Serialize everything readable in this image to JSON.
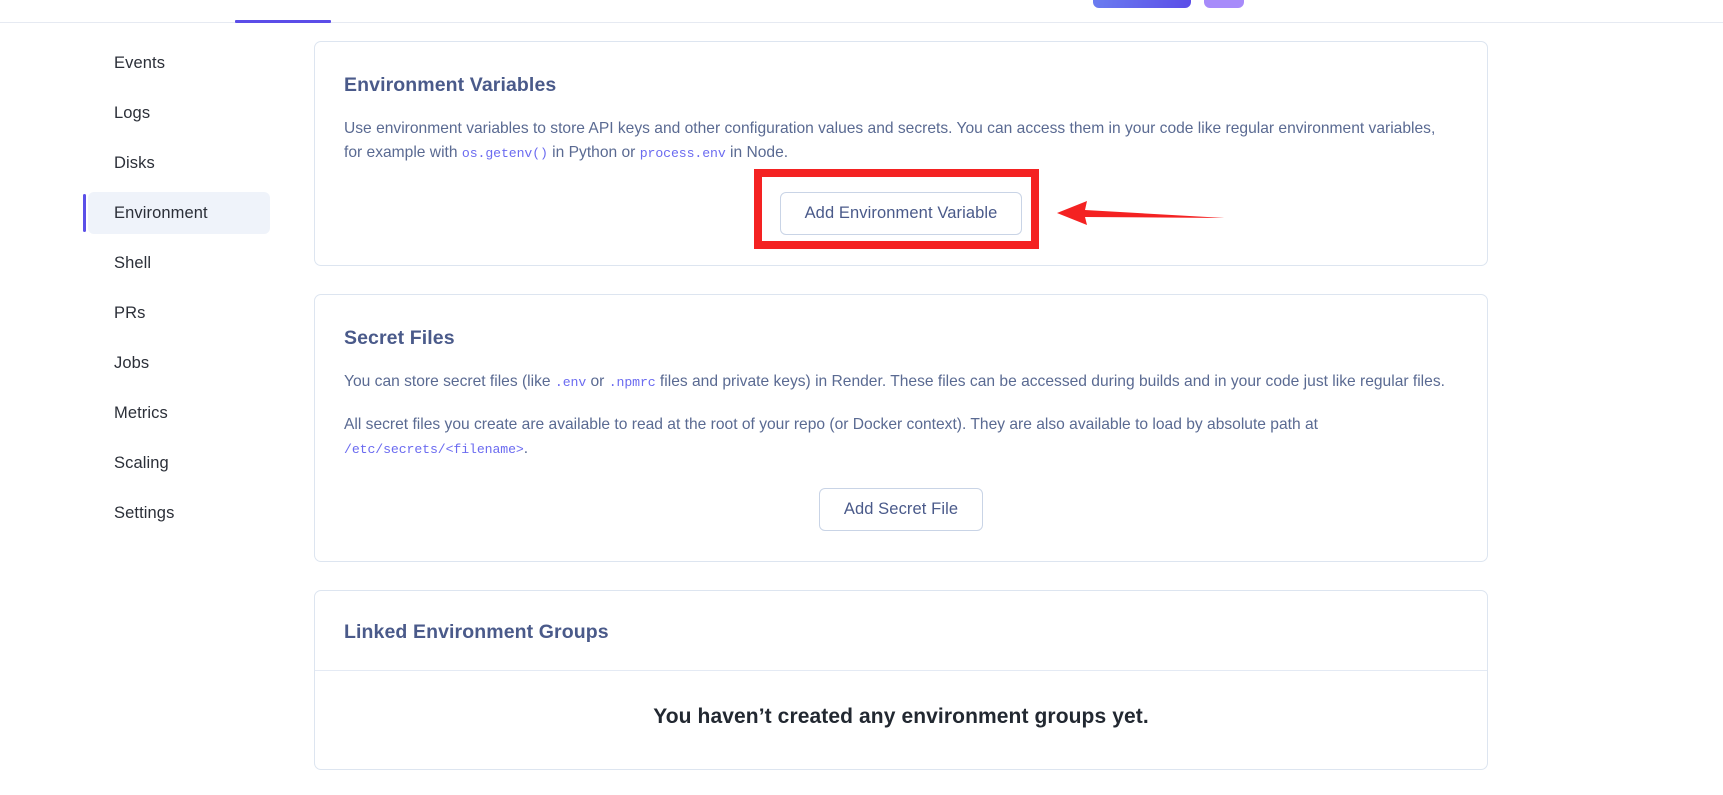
{
  "topbar": {
    "active_tab_indicator": "",
    "primary_button_label": "",
    "secondary_button_label": ""
  },
  "sidebar": {
    "items": [
      {
        "label": "Events",
        "active": false
      },
      {
        "label": "Logs",
        "active": false
      },
      {
        "label": "Disks",
        "active": false
      },
      {
        "label": "Environment",
        "active": true
      },
      {
        "label": "Shell",
        "active": false
      },
      {
        "label": "PRs",
        "active": false
      },
      {
        "label": "Jobs",
        "active": false
      },
      {
        "label": "Metrics",
        "active": false
      },
      {
        "label": "Scaling",
        "active": false
      },
      {
        "label": "Settings",
        "active": false
      }
    ]
  },
  "environment_variables": {
    "title": "Environment Variables",
    "description_part1": "Use environment variables to store API keys and other configuration values and secrets. You can access them in your code like regular environment variables, for example with ",
    "code1": "os.getenv()",
    "description_part2": " in Python or ",
    "code2": "process.env",
    "description_part3": " in Node.",
    "button_label": "Add Environment Variable"
  },
  "secret_files": {
    "title": "Secret Files",
    "para1_part1": "You can store secret files (like ",
    "para1_code1": ".env",
    "para1_part2": " or ",
    "para1_code2": ".npmrc",
    "para1_part3": " files and private keys) in Render. These files can be accessed during builds and in your code just like regular files.",
    "para2_part1": "All secret files you create are available to read at the root of your repo (or Docker context). They are also available to load by absolute path at ",
    "para2_code1": "/etc/secrets/<filename>",
    "para2_part2": ".",
    "button_label": "Add Secret File"
  },
  "linked_environment_groups": {
    "title": "Linked Environment Groups",
    "empty_message": "You haven’t created any environment groups yet."
  },
  "annotation": {
    "highlight_color": "#f42222",
    "arrow_color": "#f42222",
    "target": "Add Environment Variable"
  },
  "colors": {
    "accent": "#5b4de8",
    "secondary_accent": "#a78bfa",
    "heading": "#4a5a8a",
    "body_text": "#5a6a92",
    "code_text": "#6b6bf0",
    "card_border": "#dde5f0",
    "active_nav_bg": "#eff3fa"
  }
}
